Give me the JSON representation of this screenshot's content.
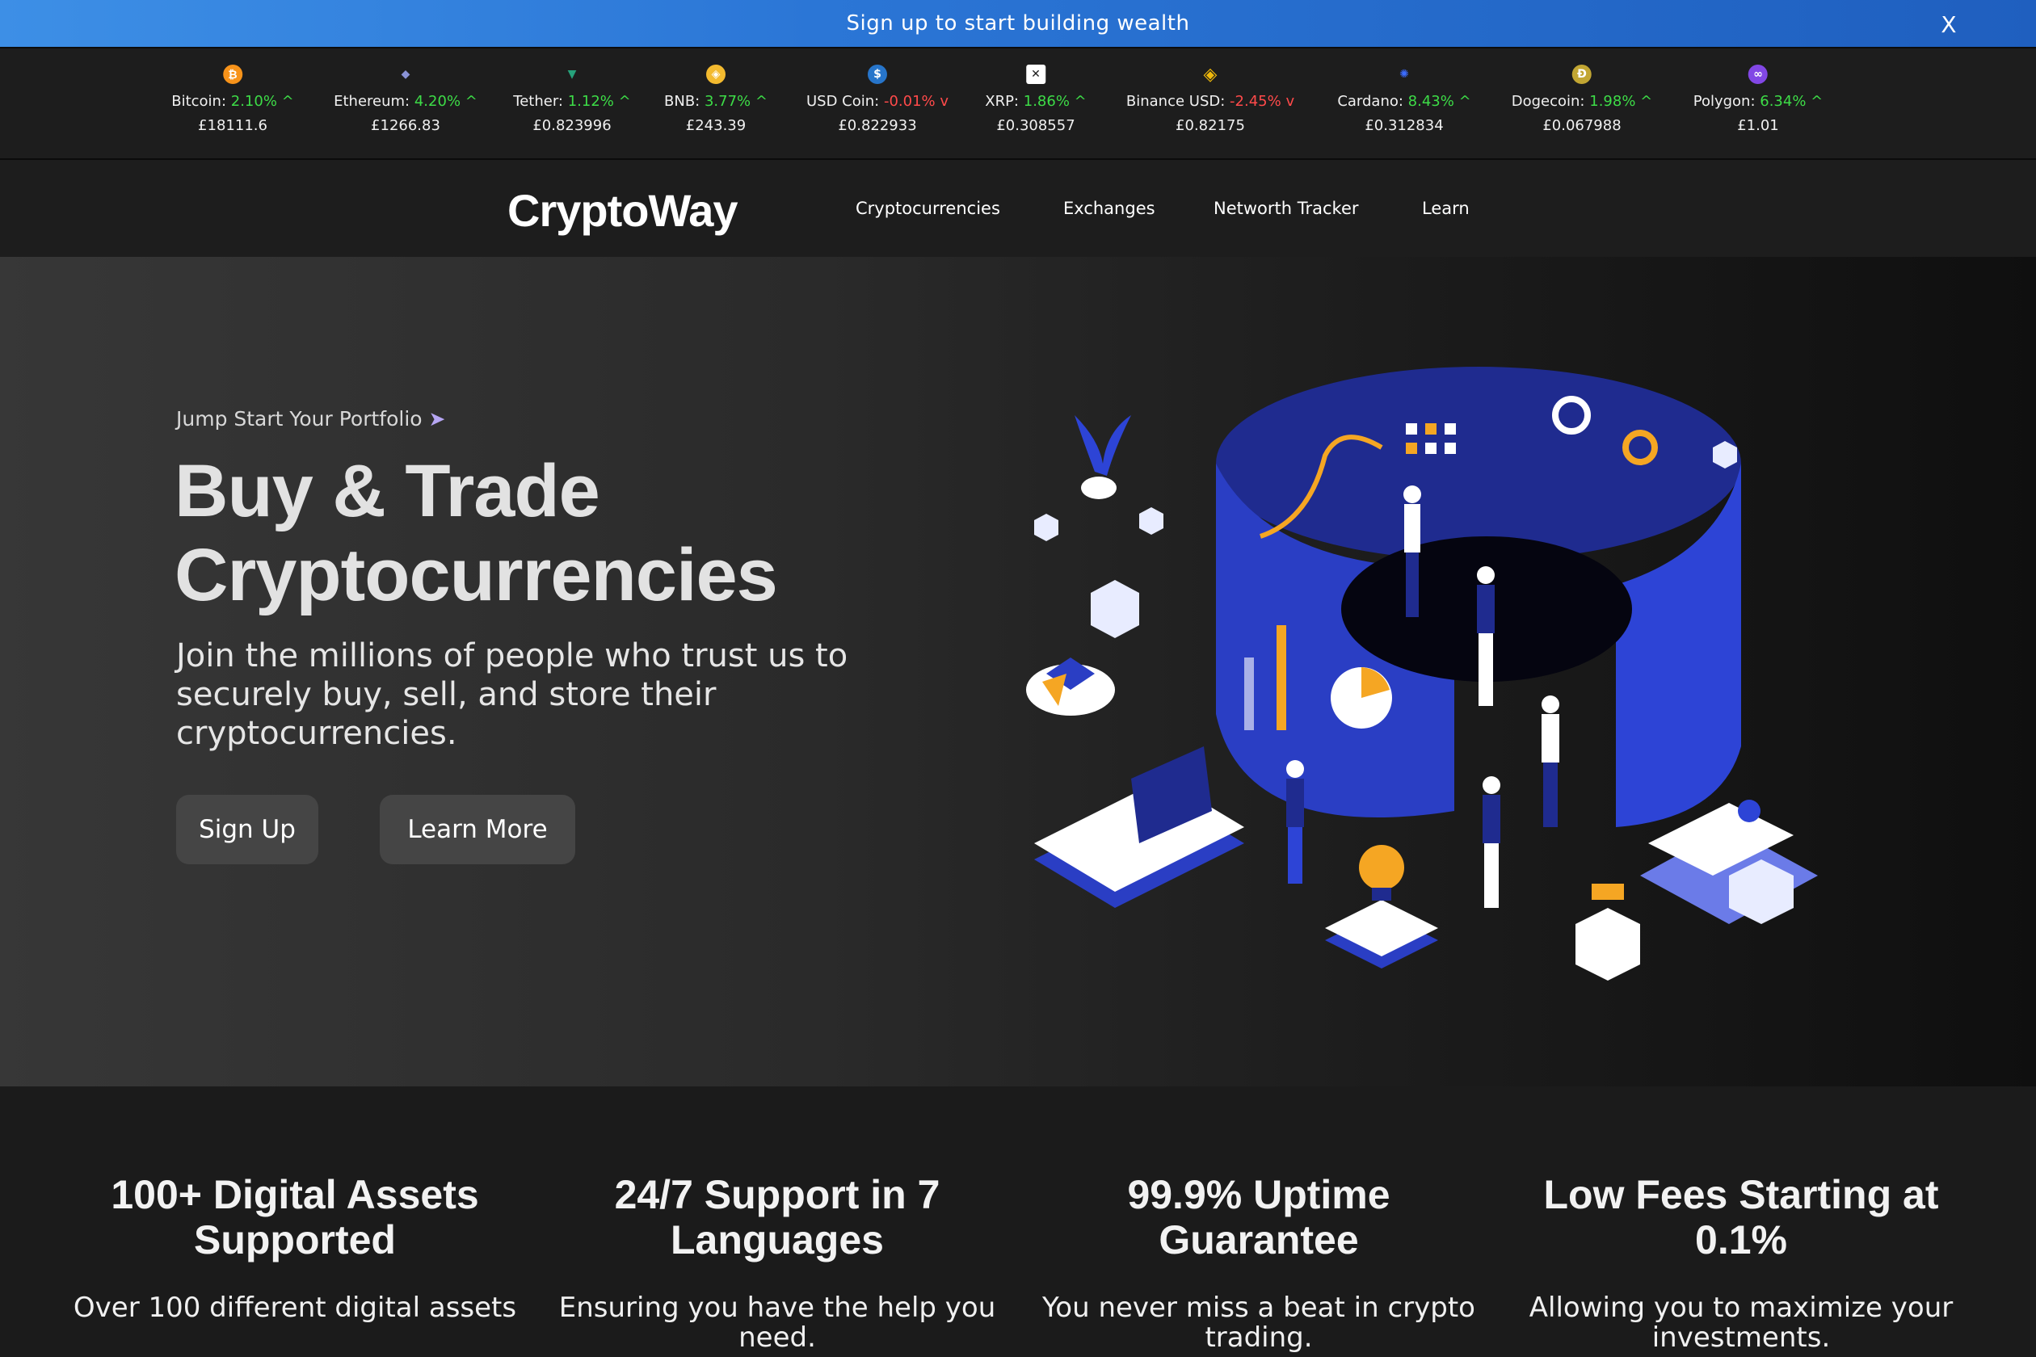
{
  "promo": {
    "text": "Sign up to start building wealth",
    "close_label": "X"
  },
  "ticker": [
    {
      "name": "Bitcoin:",
      "change": "2.10%",
      "dir": "up",
      "arrow": "^",
      "price": "£18111.6",
      "icon": "bitcoin-icon",
      "glyph": "₿",
      "color": "#f7931a"
    },
    {
      "name": "Ethereum:",
      "change": "4.20%",
      "dir": "up",
      "arrow": "^",
      "price": "£1266.83",
      "icon": "ethereum-icon",
      "glyph": "◆",
      "color": "#5c6bc0"
    },
    {
      "name": "Tether:",
      "change": "1.12%",
      "dir": "up",
      "arrow": "^",
      "price": "£0.823996",
      "icon": "tether-icon",
      "glyph": "▼",
      "color": "#26a17b"
    },
    {
      "name": "BNB:",
      "change": "3.77%",
      "dir": "up",
      "arrow": "^",
      "price": "£243.39",
      "icon": "bnb-icon",
      "glyph": "◈",
      "color": "#f3ba2f"
    },
    {
      "name": "USD Coin:",
      "change": "-0.01%",
      "dir": "down",
      "arrow": "v",
      "price": "£0.822933",
      "icon": "usd-coin-icon",
      "glyph": "$",
      "color": "#2775ca"
    },
    {
      "name": "XRP:",
      "change": "1.86%",
      "dir": "up",
      "arrow": "^",
      "price": "£0.308557",
      "icon": "xrp-icon",
      "glyph": "✕",
      "color": "#ffffff"
    },
    {
      "name": "Binance USD:",
      "change": "-2.45%",
      "dir": "down",
      "arrow": "v",
      "price": "£0.82175",
      "icon": "binance-usd-icon",
      "glyph": "◈",
      "color": "#f0b90b"
    },
    {
      "name": "Cardano:",
      "change": "8.43%",
      "dir": "up",
      "arrow": "^",
      "price": "£0.312834",
      "icon": "cardano-icon",
      "glyph": "✺",
      "color": "#0033ad"
    },
    {
      "name": "Dogecoin:",
      "change": "1.98%",
      "dir": "up",
      "arrow": "^",
      "price": "£0.067988",
      "icon": "dogecoin-icon",
      "glyph": "Ð",
      "color": "#c2a633"
    },
    {
      "name": "Polygon:",
      "change": "6.34%",
      "dir": "up",
      "arrow": "^",
      "price": "£1.01",
      "icon": "polygon-icon",
      "glyph": "∞",
      "color": "#8247e5"
    }
  ],
  "nav": {
    "logo": "CryptoWay",
    "links": [
      "Cryptocurrencies",
      "Exchanges",
      "Networth Tracker",
      "Learn"
    ]
  },
  "hero": {
    "eyebrow": "Jump Start Your Portfolio",
    "eyebrow_arrow": "➤",
    "title_line1": "Buy & Trade",
    "title_line2": "Cryptocurrencies",
    "subtitle": "Join the millions of people who trust us to securely buy, sell, and store their cryptocurrencies.",
    "signup_label": "Sign Up",
    "learn_label": "Learn More"
  },
  "features": [
    {
      "title": "100+ Digital Assets Supported",
      "desc": "Over 100 different digital assets"
    },
    {
      "title": "24/7 Support in 7 Languages",
      "desc": "Ensuring you have the help you need."
    },
    {
      "title": "99.9% Uptime Guarantee",
      "desc": "You never miss a beat in crypto trading."
    },
    {
      "title": "Low Fees Starting at 0.1%",
      "desc": "Allowing you to maximize your investments."
    }
  ],
  "colors": {
    "accent_blue": "#2b3fc6",
    "accent_orange": "#f5a623",
    "up": "#3ddc47",
    "down": "#ff4a4a"
  }
}
